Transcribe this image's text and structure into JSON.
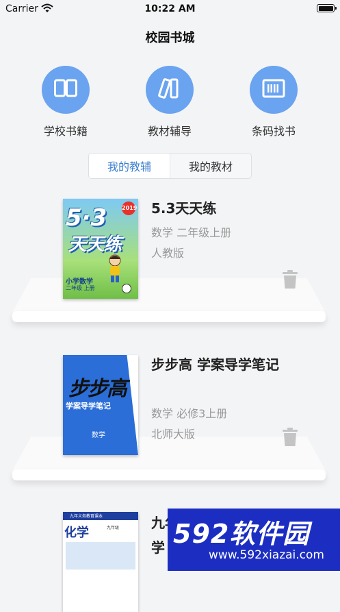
{
  "status_bar": {
    "carrier": "Carrier",
    "time": "10:22 AM"
  },
  "header": {
    "title": "校园书城"
  },
  "quick_actions": [
    {
      "label": "学校书籍",
      "icon": "open-book-icon"
    },
    {
      "label": "教材辅导",
      "icon": "books-icon"
    },
    {
      "label": "条码找书",
      "icon": "barcode-icon"
    }
  ],
  "tabs": [
    {
      "label": "我的教辅",
      "active": true
    },
    {
      "label": "我的教材",
      "active": false
    }
  ],
  "books": [
    {
      "title": "5.3天天练",
      "subject": "数学 二年级上册",
      "edition": "人教版",
      "cover": {
        "brand": "5·3",
        "series": "天天练",
        "year": "2019",
        "subject": "小学数学",
        "grade": "二年级",
        "term": "上册"
      }
    },
    {
      "title": "步步高 学案导学笔记",
      "subject": "数学 必修3上册",
      "edition": "北师大版",
      "cover": {
        "brand": "步步高",
        "series": "学案导学笔记",
        "subject": "数学"
      }
    },
    {
      "title": "九年义务教育课本 化学",
      "cover": {
        "series": "九年义务教育课本",
        "subject": "化学",
        "grade": "九年级"
      }
    }
  ],
  "watermark": {
    "logo": "592软件园",
    "url": "www.592xiazai.com"
  },
  "colors": {
    "accent": "#6aa3ef",
    "tab_active": "#3c7fd1",
    "watermark_bg": "#1c2ec2"
  }
}
